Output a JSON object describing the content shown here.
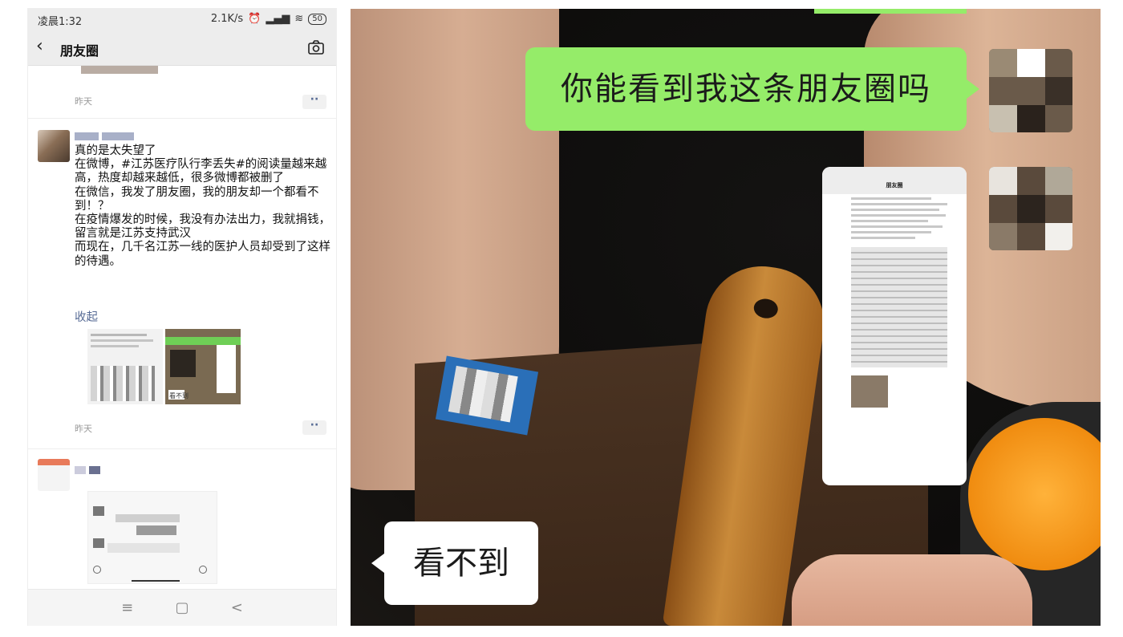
{
  "phone": {
    "status": {
      "time": "凌晨1:32",
      "speed": "2.1K/s",
      "battery": "50"
    },
    "nav": {
      "title": "朋友圈"
    },
    "post_top": {
      "time": "昨天"
    },
    "post_main": {
      "lines": [
        "真的是太失望了",
        "在微博，#江苏医疗队行李丢失#的阅读量越来越高，热度却越来越低，很多微博都被删了",
        "在微信，我发了朋友圈，我的朋友却一个都看不到！？",
        "在疫情爆发的时候，我没有办法出力，我就捐钱，留言就是江苏支持武汉",
        "而现在，几千名江苏一线的医护人员却受到了这样的待遇。"
      ],
      "collapse": "收起",
      "image_caption": "看不到",
      "time": "昨天"
    },
    "bottom_nav": {
      "menu": "≡",
      "home": "▢",
      "back": "<"
    }
  },
  "photo": {
    "green_bubble": "你能看到我这条朋友圈吗",
    "white_bubble": "看不到",
    "mini_title": "朋友圈"
  },
  "colors": {
    "wechat_green": "#95ec69",
    "link_blue": "#576b95"
  }
}
